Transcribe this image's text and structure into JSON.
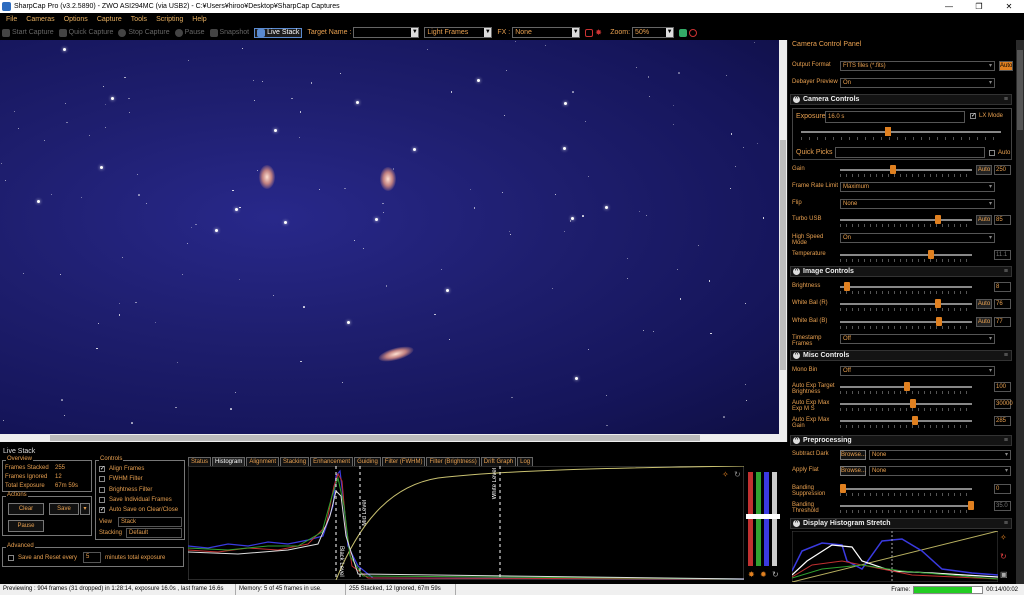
{
  "window": {
    "title": "SharpCap Pro (v3.2.5890) - ZWO ASI294MC (via USB2) - C:¥Users¥hiroo¥Desktop¥SharpCap Captures",
    "controls": [
      "—",
      "❐",
      "✕"
    ]
  },
  "menu": [
    "File",
    "Cameras",
    "Options",
    "Capture",
    "Tools",
    "Scripting",
    "Help"
  ],
  "toolbar": {
    "start_capture": "Start Capture",
    "quick_capture": "Quick Capture",
    "stop_capture": "Stop Capture",
    "pause": "Pause",
    "snapshot": "Snapshot",
    "live_stack": "Live Stack",
    "target_name_label": "Target Name :",
    "target_name_value": "",
    "frame_type": "Light Frames",
    "fx_label": "FX :",
    "fx_value": "None",
    "zoom_label": "Zoom:",
    "zoom_value": "50%"
  },
  "right_panel": {
    "title": "Camera Control Panel",
    "output_format_label": "Output Format",
    "output_format_value": "FITS files (*.fits)",
    "output_auto": "Auto",
    "debayer_label": "Debayer Preview",
    "debayer_value": "On",
    "camera_controls": "Camera Controls",
    "exposure_label": "Exposure",
    "exposure_value": "16.0 s",
    "lx_mode": "LX Mode",
    "quick_picks_label": "Quick Picks",
    "quick_picks_auto": "Auto",
    "gain_label": "Gain",
    "gain_value": "250",
    "gain_level": 0.4,
    "frame_rate_label": "Frame Rate Limit",
    "frame_rate_value": "Maximum",
    "flip_label": "Flip",
    "flip_value": "None",
    "turbo_label": "Turbo USB",
    "turbo_value": "85",
    "turbo_level": 0.75,
    "hispeed_label": "High Speed Mode",
    "hispeed_value": "On",
    "temp_label": "Temperature",
    "temp_value": "11.1",
    "temp_level": 0.7,
    "image_controls": "Image Controls",
    "brightness_label": "Brightness",
    "brightness_value": "8",
    "brightness_level": 0.03,
    "wbr_label": "White Bal (R)",
    "wbr_value": "76",
    "wbr_level": 0.75,
    "wbb_label": "White Bal (B)",
    "wbb_value": "77",
    "wbb_level": 0.76,
    "timestamp_label": "Timestamp Frames",
    "timestamp_value": "Off",
    "misc_controls": "Misc Controls",
    "monobin_label": "Mono Bin",
    "monobin_value": "Off",
    "aet_label": "Auto Exp Target Brightness",
    "aet_value": "100",
    "aem_label": "Auto Exp Max Exp M S",
    "aem_value": "30000",
    "aeg_label": "Auto Exp Max Gain",
    "aeg_value": "285",
    "auto_label": "Auto",
    "preprocessing": "Preprocessing",
    "sub_dark_label": "Subtract Dark",
    "apply_flat_label": "Apply Flat",
    "browse": "Browse...",
    "none": "None",
    "banding_sup_label": "Banding Suppression",
    "banding_sup_value": "0",
    "banding_thr_label": "Banding Threshold",
    "banding_thr_value": "35.0",
    "histogram_stretch": "Display Histogram Stretch"
  },
  "live_stack": {
    "title": "Live Stack",
    "overview": "Overview",
    "frames_stacked_label": "Frames Stacked",
    "frames_stacked": "255",
    "frames_ignored_label": "Frames Ignored",
    "frames_ignored": "12",
    "total_exposure_label": "Total Exposure",
    "total_exposure": "67m 59s",
    "actions": "Actions",
    "clear": "Clear",
    "save": "Save",
    "pause": "Pause",
    "advanced": "Advanced",
    "save_reset": "Save and Reset every",
    "save_reset_value": "5",
    "save_reset_suffix": "minutes total exposure",
    "controls": "Controls",
    "align_frames": "Align Frames",
    "fwhm_filter": "FWHM Filter",
    "brightness_filter": "Brightness Filter",
    "save_individual": "Save Individual Frames",
    "auto_save": "Auto Save on Clear/Close",
    "view_label": "View",
    "view_value": "Stack",
    "stacking_label": "Stacking",
    "stacking_value": "Default",
    "tabs": [
      "Status",
      "Histogram",
      "Alignment",
      "Stacking",
      "Enhancement",
      "Guiding",
      "Filter (FWHM)",
      "Filter (Brightness)",
      "Drift Graph",
      "Log"
    ],
    "black_level": "Black Level",
    "mid_level": "Mid Level",
    "white_level": "White Level"
  },
  "status": {
    "preview": "Previewing : 904 frames (31 dropped) in 1:28:14, exposure 16.0s , last frame 16.6s",
    "memory": "Memory: 5 of 45 frames in use.",
    "stacked": "255 Stacked, 12 Ignored, 67m 59s",
    "frame_label": "Frame:",
    "frame_time": "00:14/00:02",
    "frame_progress": 0.85
  }
}
